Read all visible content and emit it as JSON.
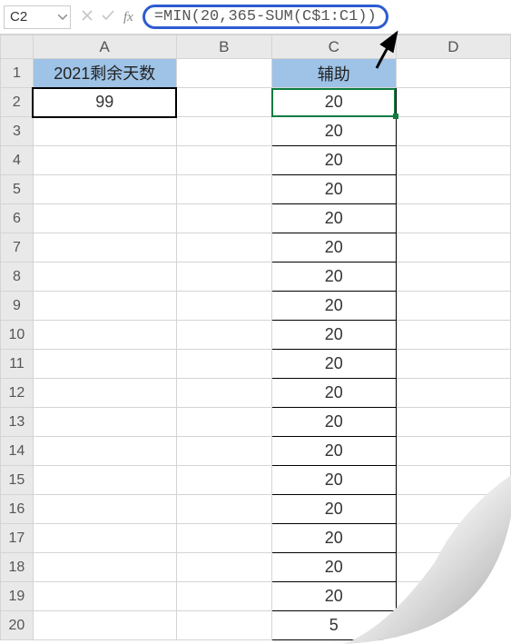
{
  "formula_bar": {
    "cell_ref": "C2",
    "formula": "=MIN(20,365-SUM(C$1:C1))",
    "fx_label": "fx"
  },
  "columns": {
    "a": "A",
    "b": "B",
    "c": "C",
    "d": "D"
  },
  "headers": {
    "a1": "2021剩余天数",
    "c1": "辅助"
  },
  "values": {
    "a2": "99"
  },
  "column_c": {
    "2": "20",
    "3": "20",
    "4": "20",
    "5": "20",
    "6": "20",
    "7": "20",
    "8": "20",
    "9": "20",
    "10": "20",
    "11": "20",
    "12": "20",
    "13": "20",
    "14": "20",
    "15": "20",
    "16": "20",
    "17": "20",
    "18": "20",
    "19": "20",
    "20": "5"
  },
  "row_numbers": [
    "1",
    "2",
    "3",
    "4",
    "5",
    "6",
    "7",
    "8",
    "9",
    "10",
    "11",
    "12",
    "13",
    "14",
    "15",
    "16",
    "17",
    "18",
    "19",
    "20"
  ],
  "chart_data": {
    "type": "table",
    "title": "2021剩余天数 / 辅助",
    "columns": [
      "2021剩余天数",
      "辅助"
    ],
    "A": [
      99
    ],
    "C": [
      20,
      20,
      20,
      20,
      20,
      20,
      20,
      20,
      20,
      20,
      20,
      20,
      20,
      20,
      20,
      20,
      20,
      20,
      5
    ]
  }
}
